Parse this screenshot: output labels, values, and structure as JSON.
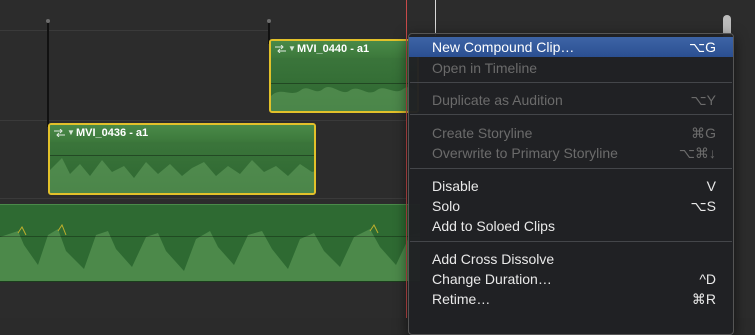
{
  "timeline": {
    "clips": [
      {
        "id": "clip-mvi-0440",
        "title": "MVI_0440 - a1"
      },
      {
        "id": "clip-mvi-0436",
        "title": "MVI_0436 - a1"
      }
    ]
  },
  "context_menu": {
    "items": [
      {
        "label": "New Compound Clip…",
        "shortcut": "⌥G",
        "enabled": true,
        "highlighted": true
      },
      {
        "label": "Open in Timeline",
        "shortcut": "",
        "enabled": false
      },
      {
        "label": "Duplicate as Audition",
        "shortcut": "⌥Y",
        "enabled": false
      },
      {
        "label": "Create Storyline",
        "shortcut": "⌘G",
        "enabled": false
      },
      {
        "label": "Overwrite to Primary Storyline",
        "shortcut": "⌥⌘↓",
        "enabled": false
      },
      {
        "label": "Disable",
        "shortcut": "V",
        "enabled": true
      },
      {
        "label": "Solo",
        "shortcut": "⌥S",
        "enabled": true
      },
      {
        "label": "Add to Soloed Clips",
        "shortcut": "",
        "enabled": true
      },
      {
        "label": "Add Cross Dissolve",
        "shortcut": "",
        "enabled": true
      },
      {
        "label": "Change Duration…",
        "shortcut": "^D",
        "enabled": true
      },
      {
        "label": "Retime…",
        "shortcut": "⌘R",
        "enabled": true
      }
    ]
  },
  "colors": {
    "clip_border": "#e2c12a",
    "audio_green": "#3f7a3e",
    "menu_highlight": "#2f5599",
    "playhead": "#c84a4a"
  },
  "icons": [
    "clip-connection-icon",
    "chevron-down-icon"
  ]
}
